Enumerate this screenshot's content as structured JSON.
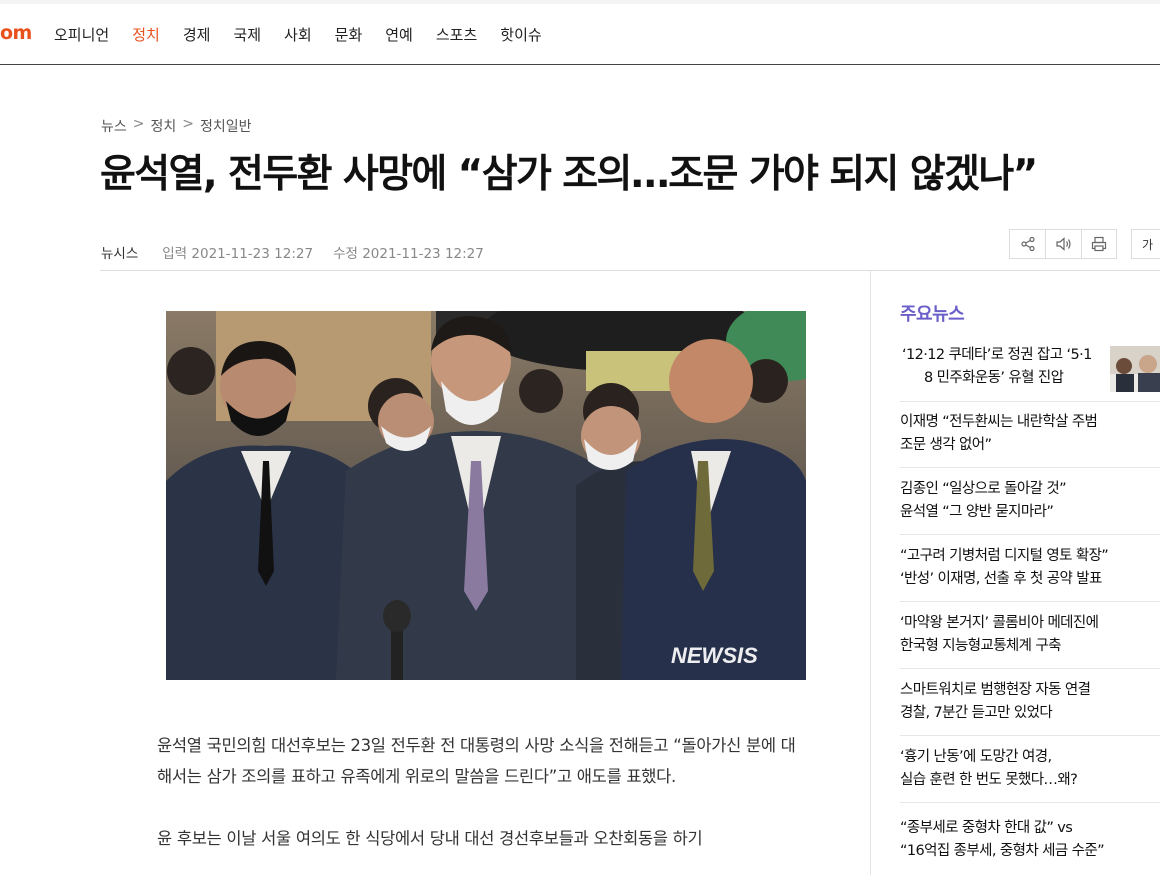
{
  "nav": {
    "logo": "om",
    "items": [
      {
        "label": "오피니언",
        "active": false
      },
      {
        "label": "정치",
        "active": true
      },
      {
        "label": "경제",
        "active": false
      },
      {
        "label": "국제",
        "active": false
      },
      {
        "label": "사회",
        "active": false
      },
      {
        "label": "문화",
        "active": false
      },
      {
        "label": "연예",
        "active": false
      },
      {
        "label": "스포츠",
        "active": false
      },
      {
        "label": "핫이슈",
        "active": false
      }
    ],
    "accent_color": "#e8501c"
  },
  "breadcrumb": [
    "뉴스",
    "정치",
    "정치일반"
  ],
  "breadcrumb_sep": ">",
  "article": {
    "title": "윤석열, 전두환 사망에 “삼가 조의…조문 가야 되지 않겠나”",
    "source": "뉴시스",
    "published": "입력 2021-11-23 12:27",
    "modified": "수정 2021-11-23 12:27",
    "photo_watermark": "NEWSIS",
    "paragraphs": [
      "윤석열 국민의힘 대선후보는 23일 전두환 전 대통령의 사망 소식을 전해듣고 “돌아가신 분에 대해서는 삼가 조의를 표하고 유족에게 위로의 말씀을 드린다”고 애도를 표했다.",
      "윤 후보는 이날 서울 여의도 한 식당에서 당내 대선 경선후보들과 오찬회동을 하기"
    ]
  },
  "tools": {
    "icons": [
      "share-icon",
      "speaker-icon",
      "print-icon"
    ],
    "font_button": "가"
  },
  "sidebar": {
    "heading": "주요뉴스",
    "heading_color": "#6a5fc9",
    "items": [
      {
        "lines": [
          "‘12·12 쿠데타’로 정권 잡고 ‘5·1",
          "8 민주화운동’ 유혈 진압"
        ],
        "has_thumb": true
      },
      {
        "lines": [
          "이재명 “전두환씨는 내란학살 주범",
          "조문 생각 없어”"
        ],
        "has_thumb": false
      },
      {
        "lines": [
          "김종인 “일상으로 돌아갈 것”",
          "윤석열 “그 양반 묻지마라”"
        ],
        "has_thumb": false
      },
      {
        "lines": [
          "“고구려 기병처럼 디지털 영토 확장”",
          "‘반성’ 이재명, 선출 후 첫 공약 발표"
        ],
        "has_thumb": false
      },
      {
        "lines": [
          "‘마약왕 본거지’ 콜롬비아 메데진에",
          "한국형 지능형교통체계 구축"
        ],
        "has_thumb": false
      },
      {
        "lines": [
          "스마트워치로 범행현장 자동 연결",
          "경찰, 7분간 듣고만 있었다"
        ],
        "has_thumb": false
      },
      {
        "lines": [
          "‘흉기 난동’에 도망간 여경,",
          "실습 훈련 한 번도 못했다…왜?"
        ],
        "has_thumb": false
      },
      {
        "lines": [
          "“종부세로 중형차 한대 값” vs",
          "“16억집 종부세, 중형차 세금 수준”"
        ],
        "has_thumb": false
      }
    ]
  }
}
